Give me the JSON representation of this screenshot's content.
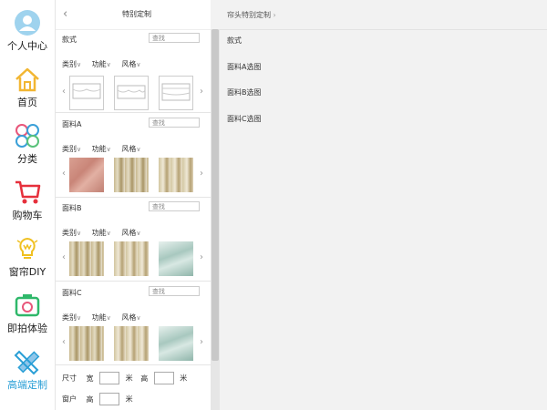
{
  "sidebar": {
    "items": [
      {
        "label": "个人中心",
        "icon": "user-avatar-icon"
      },
      {
        "label": "首页",
        "icon": "home-icon"
      },
      {
        "label": "分类",
        "icon": "category-icon"
      },
      {
        "label": "购物车",
        "icon": "cart-icon"
      },
      {
        "label": "窗帘DIY",
        "icon": "lightbulb-icon"
      },
      {
        "label": "即拍体验",
        "icon": "camera-icon"
      },
      {
        "label": "高端定制",
        "icon": "pencil-ruler-icon"
      }
    ],
    "active_index": 6,
    "active_color": "#2a9fd6"
  },
  "middle": {
    "title": "特别定制",
    "sections": [
      {
        "title": "款式",
        "search_placeholder": "查找",
        "filters": [
          "类别",
          "功能",
          "风格"
        ],
        "thumb_type": "sketch"
      },
      {
        "title": "面料A",
        "search_placeholder": "查找",
        "filters": [
          "类别",
          "功能",
          "风格"
        ],
        "thumb_type": "fabric"
      },
      {
        "title": "面料B",
        "search_placeholder": "查找",
        "filters": [
          "类别",
          "功能",
          "风格"
        ],
        "thumb_type": "fabric"
      },
      {
        "title": "面料C",
        "search_placeholder": "查找",
        "filters": [
          "类别",
          "功能",
          "风格"
        ],
        "thumb_type": "fabric"
      }
    ],
    "size": {
      "label": "尺寸",
      "width_label": "宽",
      "height_label": "高",
      "unit": "米"
    },
    "window": {
      "label": "窗户",
      "height_label": "高",
      "unit": "米"
    }
  },
  "right": {
    "breadcrumb": "帘头特别定制",
    "items": [
      "款式",
      "面料A选图",
      "面料B选图",
      "面料C选图"
    ]
  }
}
